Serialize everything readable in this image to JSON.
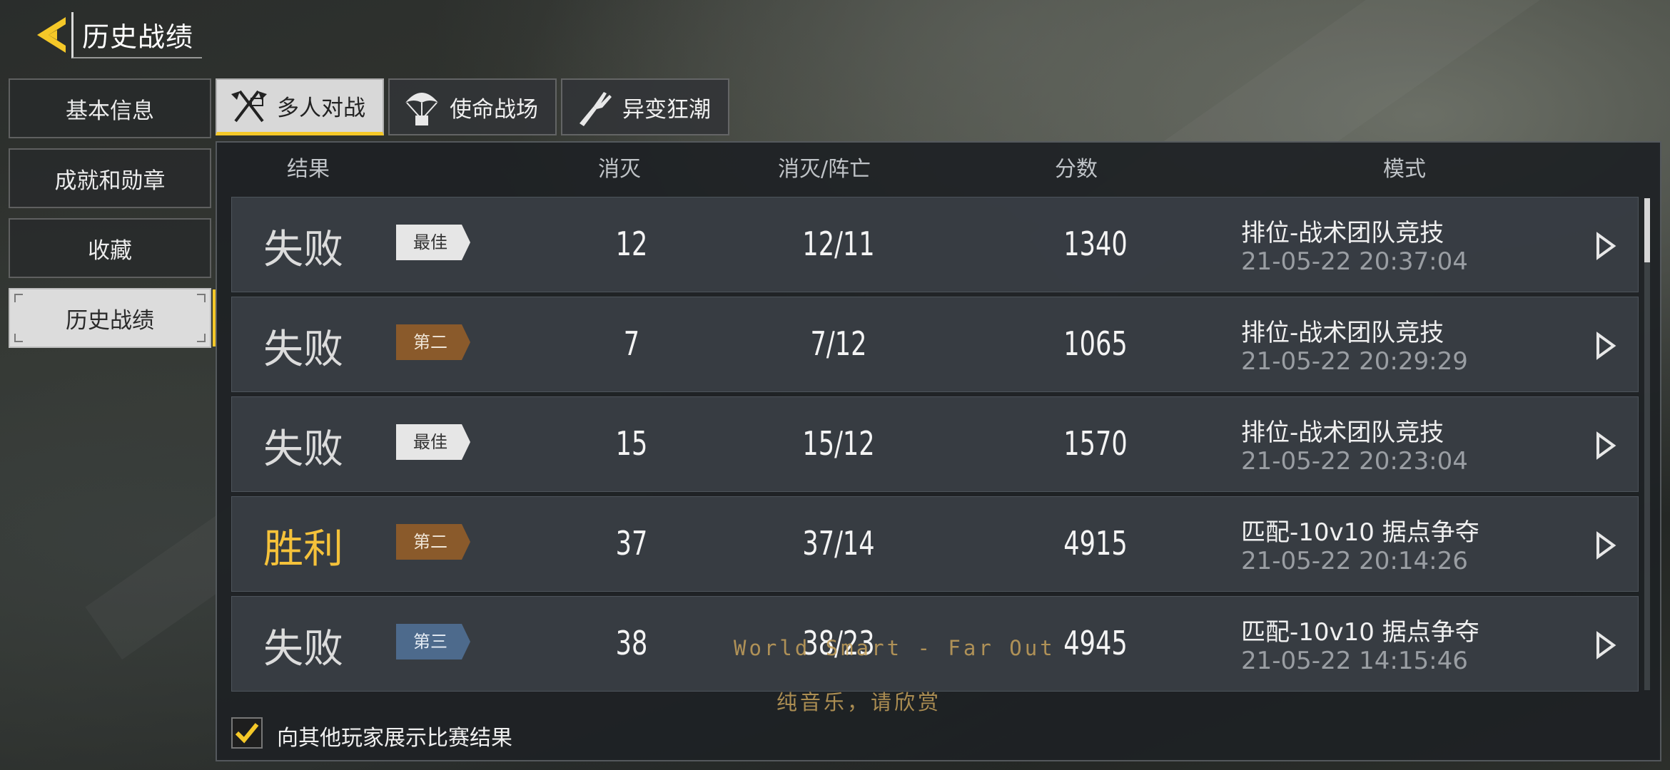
{
  "header": {
    "title": "历史战绩"
  },
  "sidebar": {
    "items": [
      {
        "label": "基本信息",
        "active": false
      },
      {
        "label": "成就和勋章",
        "active": false
      },
      {
        "label": "收藏",
        "active": false
      },
      {
        "label": "历史战绩",
        "active": true
      }
    ]
  },
  "tabs": [
    {
      "label": "多人对战",
      "icon": "crossed-flags-icon",
      "active": true
    },
    {
      "label": "使命战场",
      "icon": "parachute-icon",
      "active": false
    },
    {
      "label": "异变狂潮",
      "icon": "zombie-arm-icon",
      "active": false
    }
  ],
  "table": {
    "columns": {
      "result": "结果",
      "kills": "消灭",
      "kd": "消灭/阵亡",
      "score": "分数",
      "mode": "模式"
    },
    "rows": [
      {
        "result": "失败",
        "win": false,
        "badge": "最佳",
        "badge_style": "best",
        "kills": "12",
        "kd": "12/11",
        "score": "1340",
        "mode": "排位-战术团队竞技",
        "time": "21-05-22 20:37:04"
      },
      {
        "result": "失败",
        "win": false,
        "badge": "第二",
        "badge_style": "second",
        "kills": "7",
        "kd": "7/12",
        "score": "1065",
        "mode": "排位-战术团队竞技",
        "time": "21-05-22 20:29:29"
      },
      {
        "result": "失败",
        "win": false,
        "badge": "最佳",
        "badge_style": "best",
        "kills": "15",
        "kd": "15/12",
        "score": "1570",
        "mode": "排位-战术团队竞技",
        "time": "21-05-22 20:23:04"
      },
      {
        "result": "胜利",
        "win": true,
        "badge": "第二",
        "badge_style": "second",
        "kills": "37",
        "kd": "37/14",
        "score": "4915",
        "mode": "匹配-10v10 据点争夺",
        "time": "21-05-22 20:14:26"
      },
      {
        "result": "失败",
        "win": false,
        "badge": "第三",
        "badge_style": "third",
        "kills": "38",
        "kd": "38/23",
        "score": "4945",
        "mode": "匹配-10v10 据点争夺",
        "time": "21-05-22 14:15:46"
      }
    ]
  },
  "share": {
    "label": "向其他玩家展示比赛结果",
    "checked": true
  },
  "watermark": {
    "line1": "World Smart - Far Out",
    "line2": "纯音乐，请欣赏"
  },
  "colors": {
    "accent": "#f5c828",
    "win": "#f5c23a",
    "badge_best": "#e6e6e6",
    "badge_second": "#8a5a2b",
    "badge_third": "#4d6a8c"
  }
}
